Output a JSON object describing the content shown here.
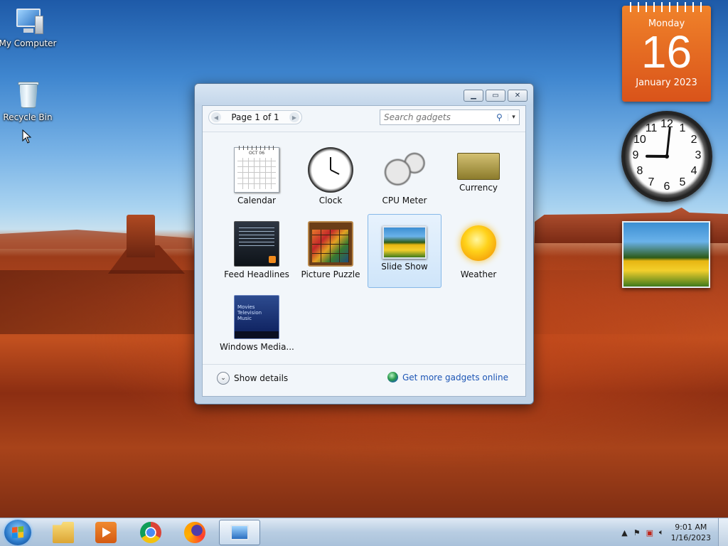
{
  "desktop": {
    "icons": [
      {
        "label": "My Computer",
        "icon": "computer-icon"
      },
      {
        "label": "Recycle Bin",
        "icon": "recycle-bin-icon"
      }
    ]
  },
  "sidebar_gadgets": {
    "calendar": {
      "weekday": "Monday",
      "day": "16",
      "month_year": "January 2023"
    },
    "clock": {
      "numerals": [
        "12",
        "1",
        "2",
        "3",
        "4",
        "5",
        "6",
        "7",
        "8",
        "9",
        "10",
        "11"
      ],
      "hour": 9,
      "minute": 1
    },
    "slideshow": {
      "subject": "yellow tulips"
    }
  },
  "gallery_window": {
    "window_buttons": {
      "minimize": "minimize-icon",
      "restore": "restore-icon",
      "close": "close-icon"
    },
    "pager": {
      "prev": "◀",
      "text": "Page 1 of 1",
      "next": "▶"
    },
    "search": {
      "placeholder": "Search gadgets",
      "icon": "search-icon",
      "dropdown": "▾"
    },
    "gadgets": [
      {
        "label": "Calendar",
        "icon": "calendar-icon",
        "thumb_text": "OCT 06"
      },
      {
        "label": "Clock",
        "icon": "clock-icon"
      },
      {
        "label": "CPU Meter",
        "icon": "cpu-meter-icon"
      },
      {
        "label": "Currency",
        "icon": "currency-icon"
      },
      {
        "label": "Feed Headlines",
        "icon": "feed-icon"
      },
      {
        "label": "Picture Puzzle",
        "icon": "puzzle-icon"
      },
      {
        "label": "Slide Show",
        "icon": "slideshow-icon",
        "selected": true
      },
      {
        "label": "Weather",
        "icon": "weather-icon"
      },
      {
        "label": "Windows Media...",
        "icon": "media-center-icon",
        "thumb_lines": [
          "Movies",
          "Television",
          "Music"
        ]
      }
    ],
    "footer": {
      "show_details": "Show details",
      "more_link": "Get more gadgets online"
    }
  },
  "taskbar": {
    "apps": [
      {
        "name": "File Explorer",
        "icon": "explorer-icon"
      },
      {
        "name": "Windows Media Player",
        "icon": "media-player-icon"
      },
      {
        "name": "Google Chrome",
        "icon": "chrome-icon"
      },
      {
        "name": "Firefox",
        "icon": "firefox-icon"
      },
      {
        "name": "Desktop Gadgets",
        "icon": "gadgets-icon",
        "active": true
      }
    ],
    "tray": {
      "time": "9:01 AM",
      "date": "1/16/2023",
      "chevron": "▲"
    }
  }
}
